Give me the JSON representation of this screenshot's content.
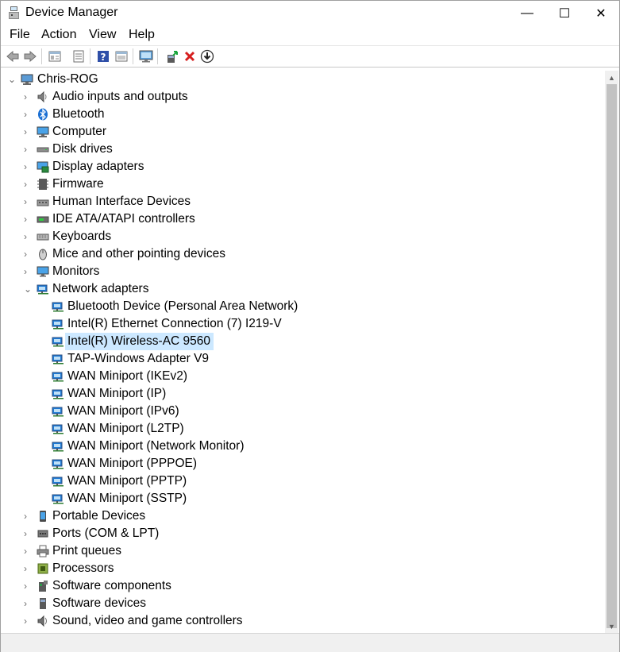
{
  "window": {
    "title": "Device Manager",
    "minimize_glyph": "—",
    "maximize_glyph": "☐",
    "close_glyph": "✕"
  },
  "menu": [
    "File",
    "Action",
    "View",
    "Help"
  ],
  "toolbar": [
    "back-icon",
    "forward-icon",
    "tree-view-icon",
    "properties-icon",
    "help-icon",
    "show-hide-icon",
    "monitor-icon",
    "update-driver-icon",
    "uninstall-icon",
    "disable-icon"
  ],
  "tree": {
    "root": "Chris-ROG",
    "categories": [
      {
        "label": "Audio inputs and outputs",
        "icon": "speaker-icon"
      },
      {
        "label": "Bluetooth",
        "icon": "bluetooth-icon"
      },
      {
        "label": "Computer",
        "icon": "computer-icon"
      },
      {
        "label": "Disk drives",
        "icon": "disk-icon"
      },
      {
        "label": "Display adapters",
        "icon": "display-adapter-icon"
      },
      {
        "label": "Firmware",
        "icon": "firmware-icon"
      },
      {
        "label": "Human Interface Devices",
        "icon": "hid-icon"
      },
      {
        "label": "IDE ATA/ATAPI controllers",
        "icon": "ide-icon"
      },
      {
        "label": "Keyboards",
        "icon": "keyboard-icon"
      },
      {
        "label": "Mice and other pointing devices",
        "icon": "mouse-icon"
      },
      {
        "label": "Monitors",
        "icon": "monitor-icon"
      },
      {
        "label": "Network adapters",
        "icon": "network-icon",
        "expanded": true
      }
    ],
    "network_adapters": [
      "Bluetooth Device (Personal Area Network)",
      "Intel(R) Ethernet Connection (7) I219-V",
      "Intel(R) Wireless-AC 9560",
      "TAP-Windows Adapter V9",
      "WAN Miniport (IKEv2)",
      "WAN Miniport (IP)",
      "WAN Miniport (IPv6)",
      "WAN Miniport (L2TP)",
      "WAN Miniport (Network Monitor)",
      "WAN Miniport (PPPOE)",
      "WAN Miniport (PPTP)",
      "WAN Miniport (SSTP)"
    ],
    "selected_adapter": "Intel(R) Wireless-AC 9560",
    "categories_after": [
      {
        "label": "Portable Devices",
        "icon": "portable-device-icon"
      },
      {
        "label": "Ports (COM & LPT)",
        "icon": "port-icon"
      },
      {
        "label": "Print queues",
        "icon": "printer-icon"
      },
      {
        "label": "Processors",
        "icon": "processor-icon"
      },
      {
        "label": "Software components",
        "icon": "software-component-icon"
      },
      {
        "label": "Software devices",
        "icon": "software-device-icon"
      },
      {
        "label": "Sound, video and game controllers",
        "icon": "sound-icon"
      }
    ]
  },
  "colors": {
    "selection": "#cce8ff",
    "network_icon": "#1e7bd6"
  }
}
